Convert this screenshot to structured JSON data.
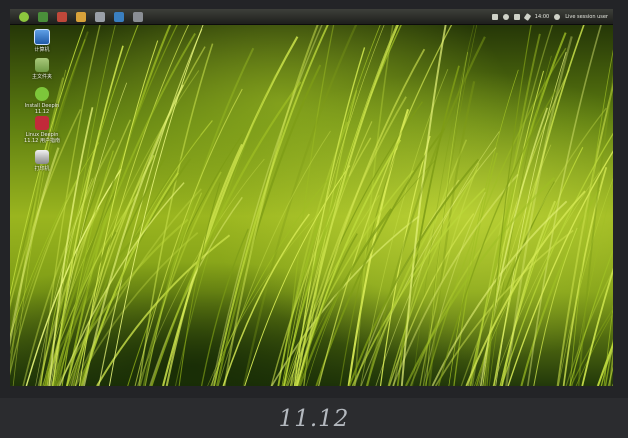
{
  "topbar": {
    "clock": "14:00",
    "session": "Live session user",
    "launcher_icon": "deepin-logo-icon",
    "colors": {
      "bar": "#2c2d2a"
    }
  },
  "desktop": {
    "icons": [
      {
        "name": "computer-icon",
        "label": "计算机"
      },
      {
        "name": "home-folder-icon",
        "label": "主文件夹"
      },
      {
        "name": "install-deepin-icon",
        "label": "Install Deepin 11.12"
      },
      {
        "name": "linux-deepin-forum-icon",
        "label": "Linux Deepin 11.12 用户指南"
      },
      {
        "name": "printer-icon",
        "label": "打印机"
      }
    ],
    "wallpaper_colors": {
      "light": "#c6dd3c",
      "mid": "#7f9d16",
      "dark": "#1c2b06"
    }
  },
  "caption": {
    "version": "11.12"
  }
}
